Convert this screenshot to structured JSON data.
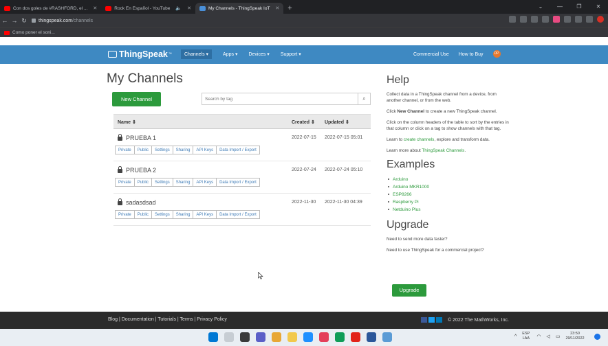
{
  "browser": {
    "tabs": [
      {
        "title": "Con dos goles de #RASHFORD, el ...",
        "icon": "youtube-favicon"
      },
      {
        "title": "Rock En Español - YouTube",
        "icon": "youtube-favicon"
      },
      {
        "title": "My Channels - ThingSpeak IoT",
        "icon": "thingspeak-favicon",
        "active": true
      }
    ],
    "url_host": "thingspeak.com",
    "url_path": "/channels",
    "bookmark": "Como poner el soni..."
  },
  "navbar": {
    "brand": "ThingSpeak",
    "brand_tm": "™",
    "links": [
      "Channels ▾",
      "Apps ▾",
      "Devices ▾",
      "Support ▾"
    ],
    "right_links": [
      "Commercial Use",
      "How to Buy"
    ],
    "avatar_initials": "DP"
  },
  "main": {
    "title": "My Channels",
    "new_channel": "New Channel",
    "search_placeholder": "Search by tag",
    "table": {
      "headers": [
        "Name ⇕",
        "Created ⇕",
        "Updated ⇕"
      ],
      "rows": [
        {
          "name": "PRUEBA 1",
          "created": "2022-07-15",
          "updated": "2022-07-15 05:01"
        },
        {
          "name": "PRUEBA 2",
          "created": "2022-07-24",
          "updated": "2022-07-24 05:10"
        },
        {
          "name": "sadasdsad",
          "created": "2022-11-30",
          "updated": "2022-11-30 04:39"
        }
      ],
      "actions": [
        "Private",
        "Public",
        "Settings",
        "Sharing",
        "API Keys",
        "Data Import / Export"
      ]
    }
  },
  "help": {
    "title": "Help",
    "p1": "Collect data in a ThingSpeak channel from a device, from another channel, or from the web.",
    "p2_prefix": "Click ",
    "p2_bold": "New Channel",
    "p2_suffix": " to create a new ThingSpeak channel.",
    "p3": "Click on the column headers of the table to sort by the entries in that column or click on a tag to show channels with that tag.",
    "p4_prefix": "Learn to ",
    "p4_link": "create channels",
    "p4_suffix": ", explore and transform data.",
    "p5_prefix": "Learn more about ",
    "p5_link": "ThingSpeak Channels",
    "p5_suffix": ".",
    "examples_title": "Examples",
    "examples": [
      "Arduino",
      "Arduino MKR1000",
      "ESP8266",
      "Raspberry Pi",
      "Netduino Plus"
    ],
    "upgrade_title": "Upgrade",
    "u1": "Need to send more data faster?",
    "u2": "Need to use ThingSpeak for a commercial project?",
    "upgrade_button": "Upgrade"
  },
  "footer": {
    "links": "Blog | Documentation | Tutorials | Terms | Privacy Policy",
    "copyright": "© 2022 The MathWorks, Inc."
  },
  "taskbar": {
    "lang": "ESP",
    "lang_sub": "LAA",
    "time": "23:50",
    "date": "29/11/2022"
  },
  "colors": {
    "navbar": "#3e89c2",
    "green": "#2c9a3c",
    "footer": "#2b2b2b"
  }
}
